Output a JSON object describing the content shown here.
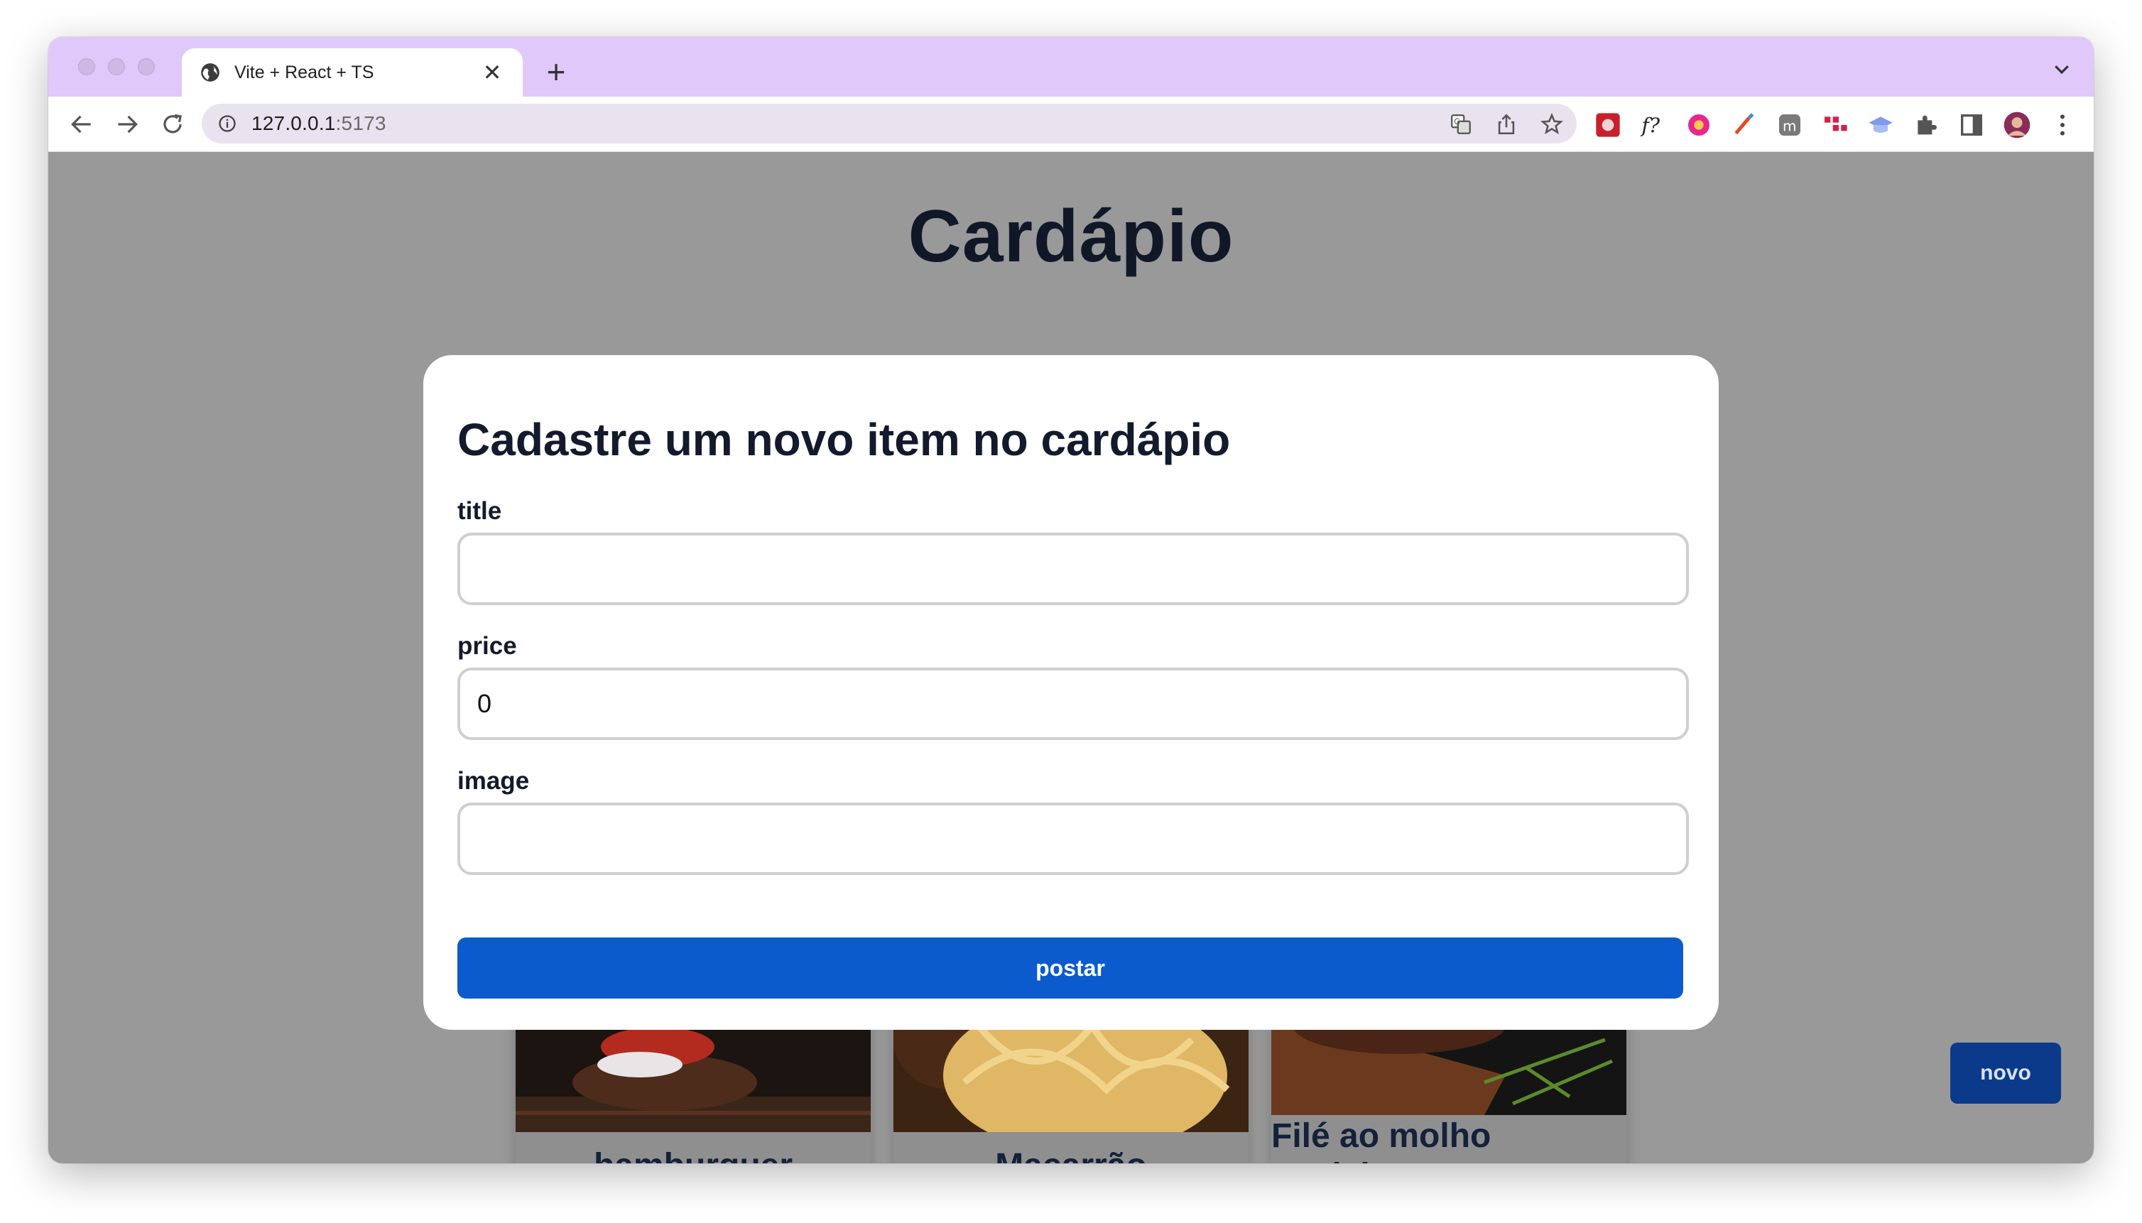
{
  "browser": {
    "tab_title": "Vite + React + TS",
    "url_host": "127.0.0.1",
    "url_port": ":5173",
    "accent": "#e0c8fb"
  },
  "page": {
    "title": "Cardápio",
    "background": "#999999",
    "novo_label": "novo"
  },
  "modal": {
    "title": "Cadastre um novo item no cardápio",
    "fields": [
      {
        "label": "title",
        "value": ""
      },
      {
        "label": "price",
        "value": "0"
      },
      {
        "label": "image",
        "value": ""
      }
    ],
    "submit_label": "postar",
    "submit_color": "#0c5bcd"
  },
  "cards": [
    {
      "title": "hamburguer",
      "image": "burger-photo"
    },
    {
      "title": "Macarrão",
      "image": "pasta-photo"
    },
    {
      "title": "Filé ao molho madeira",
      "image": "steak-photo"
    }
  ]
}
